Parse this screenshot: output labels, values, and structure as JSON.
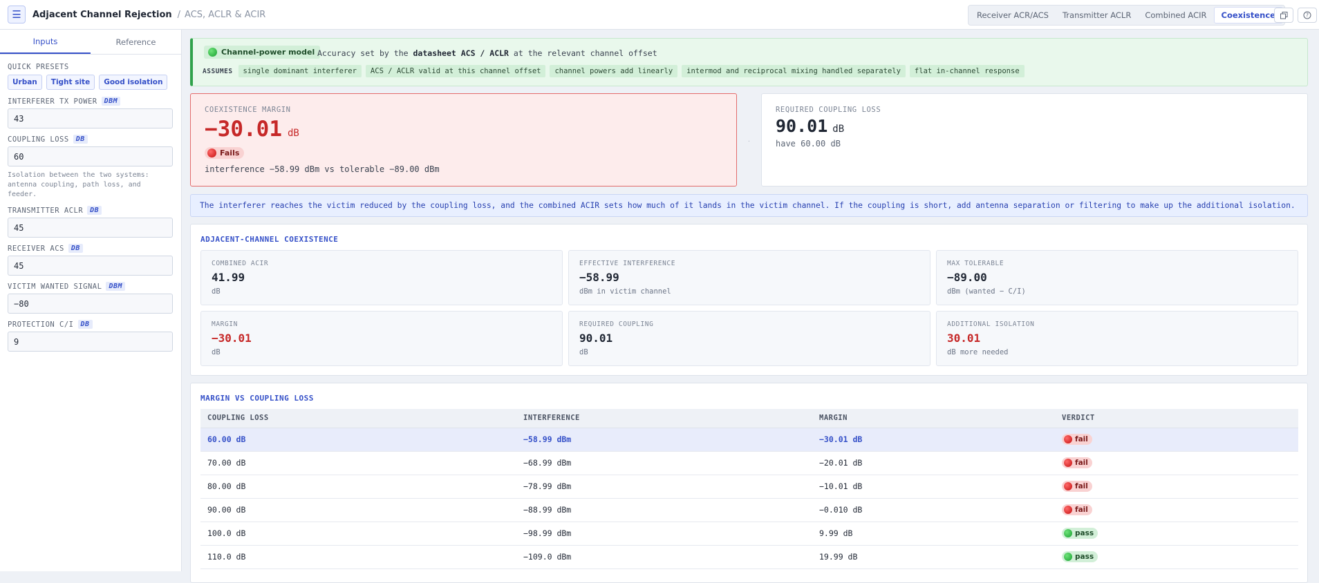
{
  "header": {
    "title": "Adjacent Channel Rejection",
    "subtitle": "ACS, ACLR & ACIR",
    "menu_icon": "hamburger-icon",
    "tabs": [
      {
        "label": "Receiver ACR/ACS",
        "active": false
      },
      {
        "label": "Transmitter ACLR",
        "active": false
      },
      {
        "label": "Combined ACIR",
        "active": false
      },
      {
        "label": "Coexistence",
        "active": true
      }
    ],
    "action_icons": [
      "copy-icon",
      "help-icon"
    ]
  },
  "sidebar": {
    "tabs": [
      {
        "label": "Inputs",
        "active": true
      },
      {
        "label": "Reference",
        "active": false
      }
    ],
    "presets_label": "QUICK PRESETS",
    "presets": [
      "Urban",
      "Tight site",
      "Good isolation"
    ],
    "fields": [
      {
        "label": "INTERFERER TX POWER",
        "unit": "DBM",
        "value": "43",
        "help": ""
      },
      {
        "label": "COUPLING LOSS",
        "unit": "DB",
        "value": "60",
        "help": "Isolation between the two systems: antenna coupling, path loss, and feeder."
      },
      {
        "label": "TRANSMITTER ACLR",
        "unit": "DB",
        "value": "45",
        "help": ""
      },
      {
        "label": "RECEIVER ACS",
        "unit": "DB",
        "value": "45",
        "help": ""
      },
      {
        "label": "VICTIM WANTED SIGNAL",
        "unit": "DBM",
        "value": "−80",
        "help": ""
      },
      {
        "label": "PROTECTION C/I",
        "unit": "DB",
        "value": "9",
        "help": ""
      }
    ]
  },
  "banner": {
    "model_label": "Channel-power model",
    "text_prefix": "Accuracy set by the",
    "text_bold": "datasheet ACS / ACLR",
    "text_suffix": "at the relevant channel offset",
    "assumes_label": "ASSUMES",
    "assumptions": [
      "single dominant interferer",
      "ACS / ACLR valid at this channel offset",
      "channel powers add linearly",
      "intermod and reciprocal mixing handled separately",
      "flat in-channel response"
    ]
  },
  "margin_card": {
    "caption": "COEXISTENCE MARGIN",
    "value": "−30.01",
    "unit": "dB",
    "status": "Fails",
    "detail": "interference −58.99 dBm vs tolerable −89.00 dBm"
  },
  "coupling_card": {
    "caption": "REQUIRED COUPLING LOSS",
    "value": "90.01",
    "unit": "dB",
    "detail": "have 60.00 dB"
  },
  "info_text": "The interferer reaches the victim reduced by the coupling loss, and the combined ACIR sets how much of it lands in the victim channel. If the coupling is short, add antenna separation or filtering to make up the additional isolation.",
  "coexistence": {
    "title": "ADJACENT-CHANNEL COEXISTENCE",
    "metrics": [
      {
        "caption": "COMBINED ACIR",
        "value": "41.99",
        "sub": "dB",
        "tone": "normal"
      },
      {
        "caption": "EFFECTIVE INTERFERENCE",
        "value": "−58.99",
        "sub": "dBm in victim channel",
        "tone": "normal"
      },
      {
        "caption": "MAX TOLERABLE",
        "value": "−89.00",
        "sub": "dBm (wanted − C/I)",
        "tone": "normal"
      },
      {
        "caption": "MARGIN",
        "value": "−30.01",
        "sub": "dB",
        "tone": "bad"
      },
      {
        "caption": "REQUIRED COUPLING",
        "value": "90.01",
        "sub": "dB",
        "tone": "normal"
      },
      {
        "caption": "ADDITIONAL ISOLATION",
        "value": "30.01",
        "sub": "dB more needed",
        "tone": "bad"
      }
    ]
  },
  "sweep": {
    "title": "MARGIN VS COUPLING LOSS",
    "columns": [
      "COUPLING LOSS",
      "INTERFERENCE",
      "MARGIN",
      "VERDICT"
    ],
    "rows": [
      {
        "coupling": "60.00 dB",
        "interference": "−58.99 dBm",
        "margin": "−30.01 dB",
        "verdict": "fail",
        "current": true
      },
      {
        "coupling": "70.00 dB",
        "interference": "−68.99 dBm",
        "margin": "−20.01 dB",
        "verdict": "fail",
        "current": false
      },
      {
        "coupling": "80.00 dB",
        "interference": "−78.99 dBm",
        "margin": "−10.01 dB",
        "verdict": "fail",
        "current": false
      },
      {
        "coupling": "90.00 dB",
        "interference": "−88.99 dBm",
        "margin": "−0.010 dB",
        "verdict": "fail",
        "current": false
      },
      {
        "coupling": "100.0 dB",
        "interference": "−98.99 dBm",
        "margin": "9.99 dB",
        "verdict": "pass",
        "current": false
      },
      {
        "coupling": "110.0 dB",
        "interference": "−109.0 dBm",
        "margin": "19.99 dB",
        "verdict": "pass",
        "current": false
      }
    ]
  }
}
